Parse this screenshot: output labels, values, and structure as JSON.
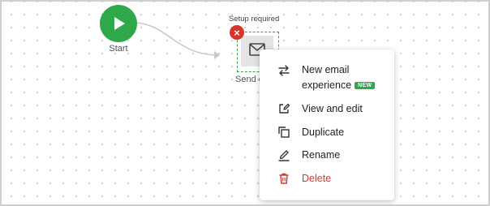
{
  "canvas": {
    "start_node": {
      "label": "Start",
      "icon": "play-icon",
      "color": "#2ea84a"
    },
    "email_node": {
      "status": "Setup required",
      "label": "Send e",
      "icon": "envelope-icon",
      "error_icon": "close-icon",
      "error_color": "#d8342b"
    }
  },
  "context_menu": {
    "items": [
      {
        "line1": "New email",
        "line2": "experience",
        "badge": "NEW",
        "icon": "swap-arrows-icon"
      },
      {
        "label": "View and edit",
        "icon": "edit-icon"
      },
      {
        "label": "Duplicate",
        "icon": "duplicate-icon"
      },
      {
        "label": "Rename",
        "icon": "rename-icon"
      },
      {
        "label": "Delete",
        "icon": "trash-icon",
        "color": "#d23a2a"
      }
    ]
  }
}
